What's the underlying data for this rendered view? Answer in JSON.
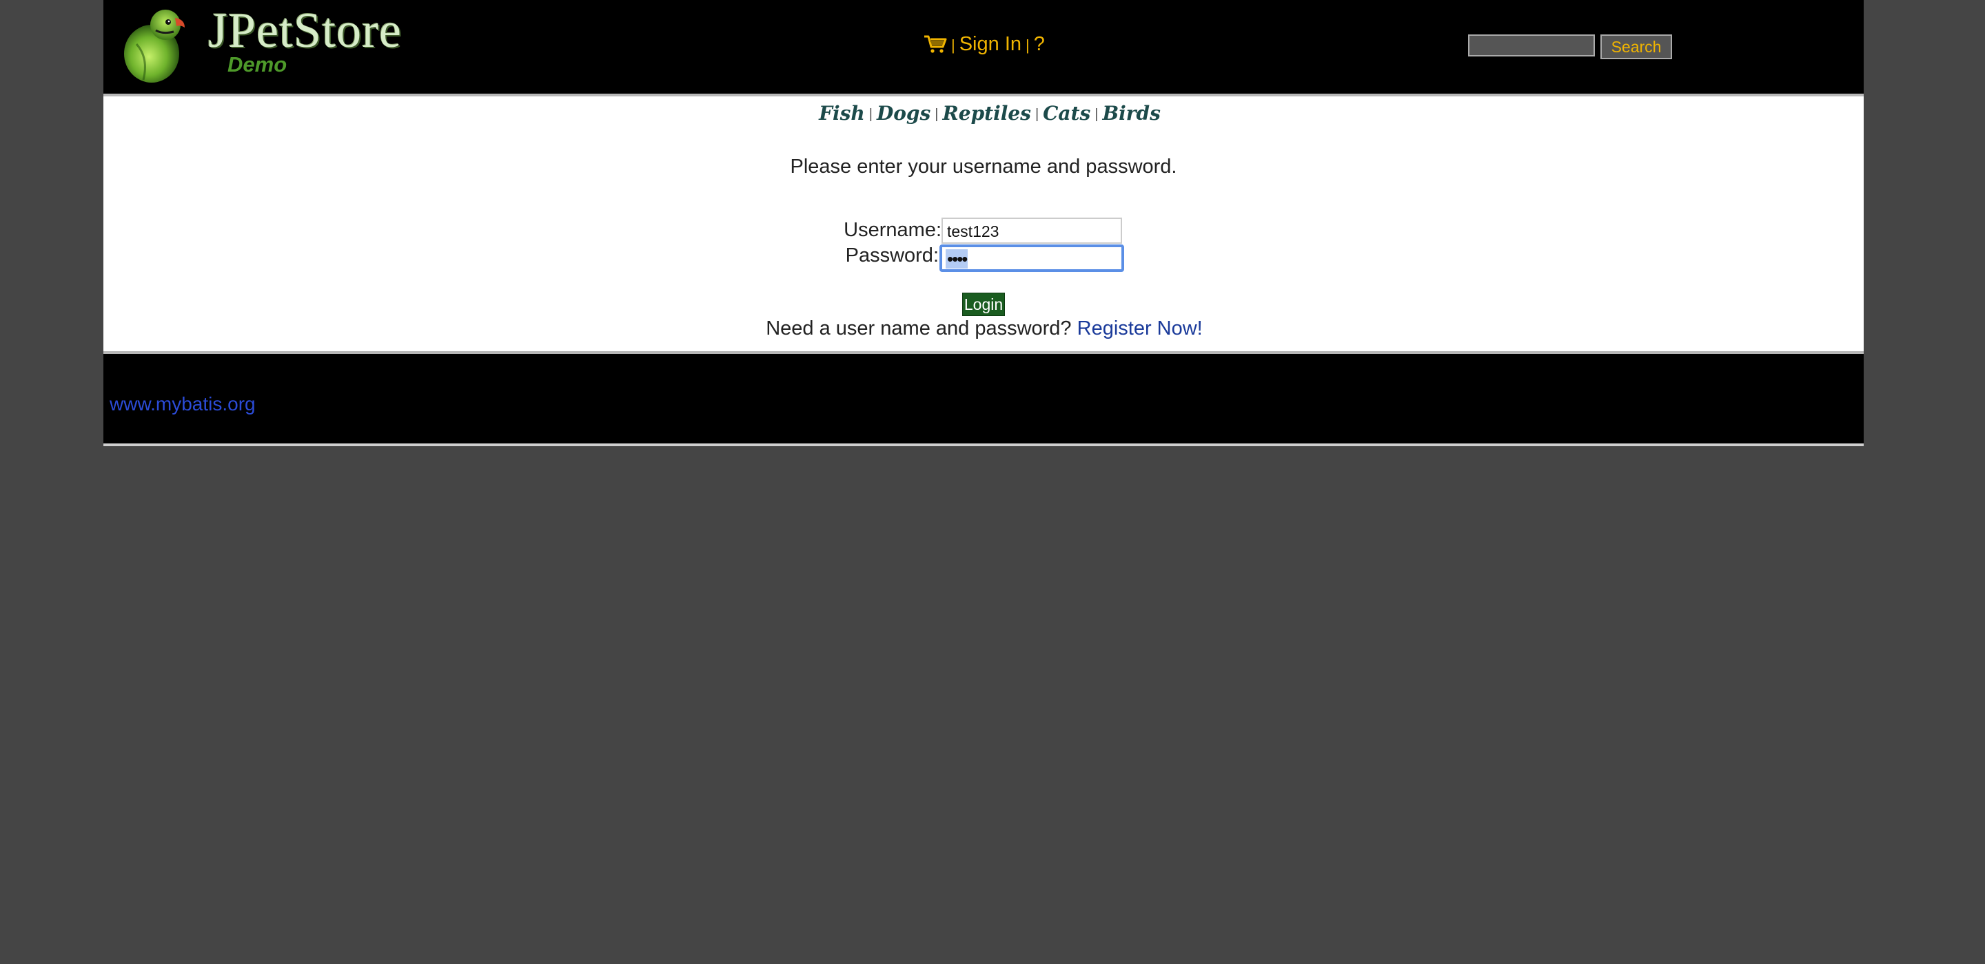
{
  "header": {
    "logo_title": "JPetStore",
    "logo_subtitle": "Demo",
    "menu": {
      "cart_icon": "shopping-cart-icon",
      "sign_in_label": "Sign In",
      "help_label": "?"
    },
    "search": {
      "value": "",
      "button_label": "Search"
    }
  },
  "quicklinks": [
    "Fish",
    "Dogs",
    "Reptiles",
    "Cats",
    "Birds"
  ],
  "login": {
    "prompt": "Please enter your username and password.",
    "username_label": "Username:",
    "username_value": "test123",
    "password_label": "Password:",
    "password_masked": "••••",
    "login_button": "Login",
    "register_prompt": "Need a user name and password?",
    "register_link": "Register Now!"
  },
  "footer": {
    "link": "www.mybatis.org"
  },
  "colors": {
    "page_background": "#454545",
    "header_background": "#000000",
    "menu_accent": "#f0b400",
    "login_button": "#1a5c20",
    "link": "#1a3a9a",
    "footer_link": "#2b4bd6"
  }
}
